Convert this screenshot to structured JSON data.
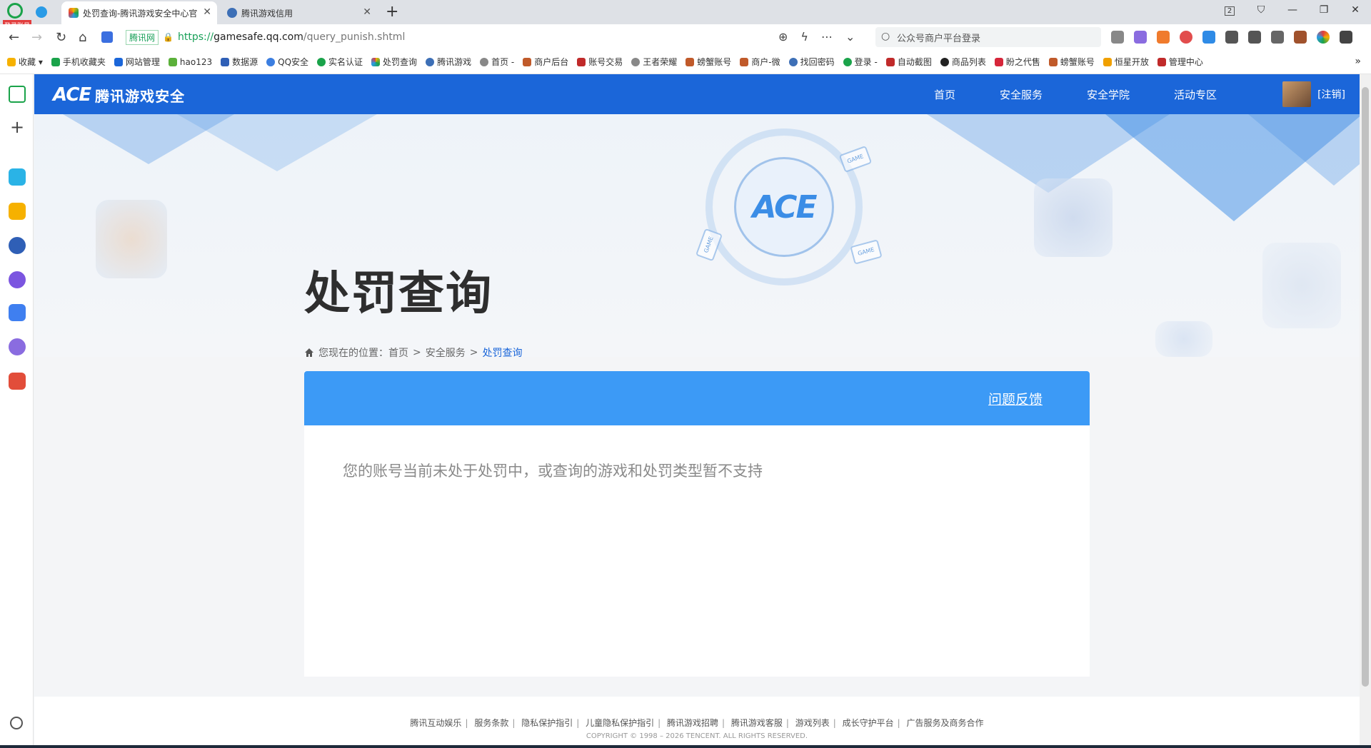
{
  "browser": {
    "corner_tag": "登录账号",
    "tabs": [
      {
        "label": "处罚查询-腾讯游戏安全中心官",
        "active": true
      },
      {
        "label": "腾讯游戏信用",
        "active": false
      }
    ],
    "tab_count": "2",
    "url": {
      "badge": "腾讯网",
      "scheme": "https://",
      "host": "gamesafe.qq.com",
      "path": "/query_punish.shtml"
    },
    "search_placeholder": "公众号商户平台登录",
    "bookmarks": [
      "收藏",
      "手机收藏夹",
      "网站管理",
      "hao123",
      "数据源",
      "QQ安全",
      "实名认证",
      "处罚查询",
      "腾讯游戏",
      "首页 -",
      "商户后台",
      "账号交易",
      "王者荣耀",
      "螃蟹账号",
      "商户-微",
      "找回密码",
      "登录 -",
      "自动截图",
      "商品列表",
      "盼之代售",
      "螃蟹账号",
      "恒星开放",
      "管理中心"
    ]
  },
  "site": {
    "brand_logo": "ACE",
    "brand_name": "腾讯游戏安全",
    "nav": [
      "首页",
      "安全服务",
      "安全学院",
      "活动专区"
    ],
    "logout": "[注销]"
  },
  "banner": {
    "center_logo": "ACE",
    "game_card_label": "GAME"
  },
  "page": {
    "title": "处罚查询",
    "breadcrumb": {
      "prefix": "您现在的位置：",
      "items": [
        "首页",
        "安全服务",
        "处罚查询"
      ],
      "separator": ">"
    },
    "feedback": "问题反馈",
    "result": "您的账号当前未处于处罚中，或查询的游戏和处罚类型暂不支持"
  },
  "footer": {
    "links": [
      "腾讯互动娱乐",
      "服务条款",
      "隐私保护指引",
      "儿童隐私保护指引",
      "腾讯游戏招聘",
      "腾讯游戏客服",
      "游戏列表",
      "成长守护平台",
      "广告服务及商务合作"
    ],
    "link_separator": "|",
    "copyright": "COPYRIGHT © 1998 – 2026 TENCENT. ALL RIGHTS RESERVED."
  },
  "colors": {
    "nav_blue": "#1b66d9",
    "panel_head": "#3c9af6",
    "crumb_active": "#1b66d9"
  }
}
